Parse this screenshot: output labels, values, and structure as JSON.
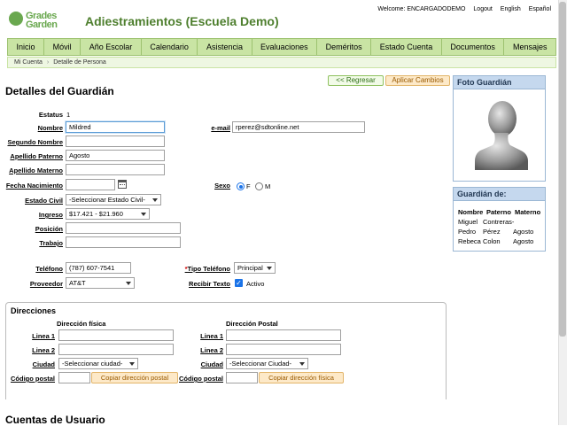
{
  "header": {
    "logo_line1": "Grades",
    "logo_line2": "Garden",
    "app_title": "Adiestramientos (Escuela Demo)",
    "welcome": "Welcome: ENCARGADODEMO",
    "logout": "Logout",
    "lang_en": "English",
    "lang_es": "Español"
  },
  "nav": [
    "Inicio",
    "Móvil",
    "Año Escolar",
    "Calendario",
    "Asistencia",
    "Evaluaciones",
    "Deméritos",
    "Estado Cuenta",
    "Documentos",
    "Mensajes"
  ],
  "breadcrumb": {
    "item1": "Mi Cuenta",
    "item2": "Detalle de Persona"
  },
  "actions": {
    "back": "<< Regresar",
    "apply": "Aplicar Cambios"
  },
  "title": "Detalles del Guardián",
  "form": {
    "estatus_label": "Estatus",
    "estatus_value": "1",
    "nombre_label": "Nombre",
    "nombre_value": "Mildred",
    "email_label": "e-mail",
    "email_value": "rperez@sdtonline.net",
    "segundo_label": "Segundo Nombre",
    "segundo_value": "",
    "paterno_label": "Apellido Paterno",
    "paterno_value": "Agosto",
    "materno_label": "Apellido Materno",
    "materno_value": "",
    "nacimiento_label": "Fecha Nacimiento",
    "nacimiento_value": "",
    "sexo_label": "Sexo",
    "sexo_f": "F",
    "sexo_m": "M",
    "sexo_selected": "F",
    "civil_label": "Estado Civil",
    "civil_value": "-Seleccionar Estado Civil-",
    "ingreso_label": "Ingreso",
    "ingreso_value": "$17.421 - $21.960",
    "posicion_label": "Posición",
    "posicion_value": "",
    "trabajo_label": "Trabajo",
    "trabajo_value": "",
    "telefono_label": "Teléfono",
    "telefono_value": "(787) 607-7541",
    "tipo_tel_label": "Tipo Teléfono",
    "tipo_tel_value": "Principal",
    "proveedor_label": "Proveedor",
    "proveedor_value": "AT&T",
    "recibir_label": "Recibir Texto",
    "recibir_value": "Activo",
    "recibir_checked": true
  },
  "direcciones": {
    "title": "Direcciones",
    "fisica": "Dirección física",
    "postal": "Dirección Postal",
    "linea1": "Linea 1",
    "linea2": "Linea 2",
    "ciudad": "Ciudad",
    "codigo": "Código postal",
    "ciudad_sel_fisica": "-Seleccionar ciudad-",
    "ciudad_sel_postal": "-Seleccionar Ciudad-",
    "copy_postal": "Copiar dirección postal",
    "copy_fisica": "Copiar dirección física"
  },
  "cuentas_title": "Cuentas de Usuario",
  "foto_panel": {
    "title": "Foto Guardián"
  },
  "guardian_de": {
    "title": "Guardián de:",
    "headers": [
      "Nombre",
      "Paterno",
      "Materno"
    ],
    "rows": [
      [
        "Miguel",
        "Contreras-",
        ""
      ],
      [
        "Pedro",
        "Pérez",
        "Agosto"
      ],
      [
        "Rebeca",
        "Colon",
        "Agosto"
      ]
    ]
  },
  "colors": {
    "nav_bg": "#c9e4a4",
    "brand_green": "#4e7f2e",
    "panel_header": "#c5d8ee"
  }
}
